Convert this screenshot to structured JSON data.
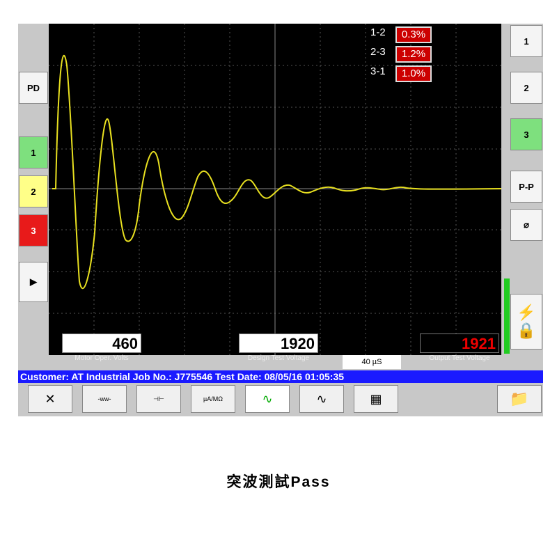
{
  "left_buttons": [
    "PD",
    "1",
    "2",
    "3"
  ],
  "right_buttons": [
    "1",
    "2",
    "3",
    "P-P"
  ],
  "phase_diffs": [
    {
      "label": "1-2",
      "value": "0.3%"
    },
    {
      "label": "2-3",
      "value": "1.2%"
    },
    {
      "label": "3-1",
      "value": "1.0%"
    }
  ],
  "motor_volts": "460",
  "motor_label": "Motor Oper. Volts",
  "design_voltage": "1920",
  "design_label": "Design Test Voltage",
  "timebase": "40 µS",
  "output_voltage": "1921",
  "output_label": "Output Test Voltage",
  "status": "Customer: AT Industrial   Job No.: J775546   Test Date: 08/05/16 01:05:35",
  "tool_ohm": "µA/MΩ",
  "caption": "突波測試Pass",
  "colors": {
    "trace": "#e8e020",
    "pass": "#22cc22"
  }
}
